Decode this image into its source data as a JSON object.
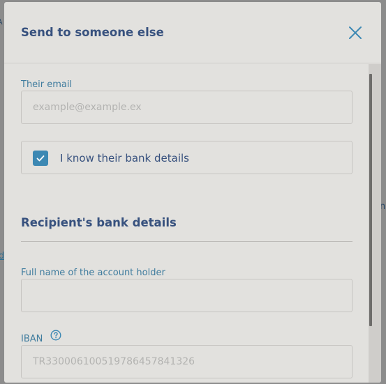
{
  "modal": {
    "title": "Send to someone else",
    "close_icon": "close-icon"
  },
  "email_field": {
    "label": "Their email",
    "value": "",
    "placeholder": "example@example.ex"
  },
  "bank_details_checkbox": {
    "label": "I know their bank details",
    "checked": true,
    "check_icon": "checkmark-icon"
  },
  "recipient_section": {
    "title": "Recipient's bank details"
  },
  "account_holder_field": {
    "label": "Full name of the account holder",
    "value": "",
    "placeholder": ""
  },
  "iban_field": {
    "label": "IBAN",
    "help_icon": "question-circle-icon",
    "value": "",
    "placeholder": "TR330006100519786457841326"
  },
  "background_fragments": {
    "left_top": "A",
    "left_link": "d",
    "right_text": "na"
  },
  "colors": {
    "accent": "#3c88b3",
    "title_text": "#37517e",
    "label_text": "#3f7c9e",
    "modal_bg": "#e2e1de",
    "overlay": "#8c8c8c"
  }
}
